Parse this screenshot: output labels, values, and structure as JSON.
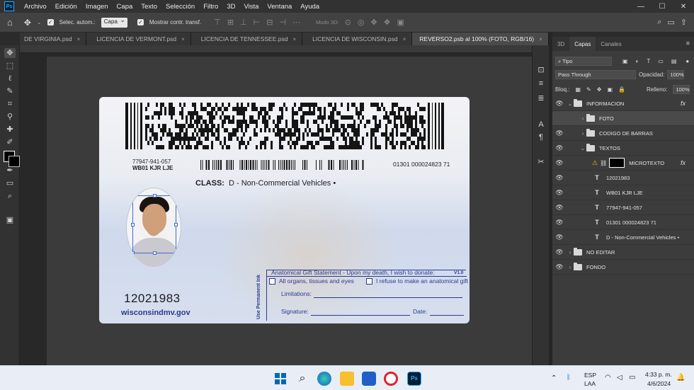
{
  "app": {
    "logo": "Ps",
    "menu": [
      "Archivo",
      "Edición",
      "Imagen",
      "Capa",
      "Texto",
      "Selección",
      "Filtro",
      "3D",
      "Vista",
      "Ventana",
      "Ayuda"
    ],
    "window_controls": [
      "—",
      "☐",
      "✕"
    ]
  },
  "options": {
    "auto_select_label": "Selec. autom.:",
    "auto_select_value": "Capa",
    "transform_label": "Mostrar contr. transf.",
    "mode3d_label": "Modo 3D:"
  },
  "tabs": [
    {
      "label": "DE VIRGINIA.psd",
      "close": "×"
    },
    {
      "label": "LICENCIA DE VERMONT.psd",
      "close": "×"
    },
    {
      "label": "LICENCIA DE TENNESSEE.psd",
      "close": "×"
    },
    {
      "label": "LICENCIA DE WISCONSIN.psd",
      "close": "×"
    },
    {
      "label": "REVERSO2.psb al 100% (FOTO, RGB/16)",
      "close": "×"
    }
  ],
  "card": {
    "id_line1": "77947-941-057",
    "id_line2": "WB01 KJR LJE",
    "serial": "01301 000024823 71",
    "class_label": "CLASS:",
    "class_value": "D - Non-Commercial Vehicles •",
    "number": "12021983",
    "website": "wisconsindmv.gov",
    "gift_title": "Anatomical Gift Statement - Upon my death, I wish to donate:",
    "gift_version": "V1.0",
    "gift_opt1": "All organs, tissues and eyes",
    "gift_opt2": "I refuse to make an anatomical gift",
    "limitations": "Limitations:",
    "signature": "Signature:",
    "date": "Date:",
    "vertical": "Use Permanent Ink"
  },
  "panels": {
    "tabs": [
      "3D",
      "Capas",
      "Canales"
    ],
    "filter_value": "Tipo",
    "blend_mode": "Pass Through",
    "opacity_label": "Opacidad:",
    "opacity_value": "100%",
    "lock_label": "Bloq.:",
    "fill_label": "Relleno:",
    "fill_value": "100%",
    "fx_label": "fx",
    "layers": [
      {
        "name": "INFORMACION",
        "kind": "group",
        "expanded": true
      },
      {
        "name": "FOTO",
        "kind": "group",
        "expanded": false
      },
      {
        "name": "CODIGO DE BARRAS",
        "kind": "group",
        "expanded": false
      },
      {
        "name": "TEXTOS",
        "kind": "group",
        "expanded": true
      },
      {
        "name": "MICROTEXTO",
        "kind": "smart"
      },
      {
        "name": "12021983",
        "kind": "text"
      },
      {
        "name": "WB01 KJR LJE",
        "kind": "text"
      },
      {
        "name": "77947-941-057",
        "kind": "text"
      },
      {
        "name": "01301 000024823 71",
        "kind": "text"
      },
      {
        "name": "D - Non-Commercial Vehicles •",
        "kind": "text"
      },
      {
        "name": "NO EDITAR",
        "kind": "group",
        "expanded": false
      },
      {
        "name": "FONDO",
        "kind": "group",
        "expanded": false
      }
    ]
  },
  "taskbar": {
    "lang1": "ESP",
    "lang2": "LAA",
    "time": "4:33 p. m.",
    "date": "4/6/2024"
  }
}
